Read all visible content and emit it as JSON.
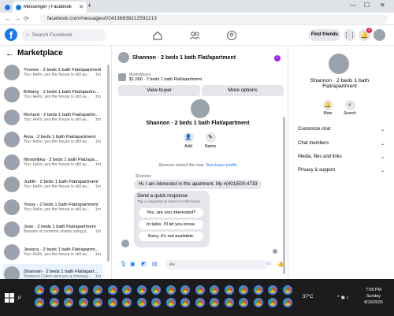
{
  "browser": {
    "tab_inactive_title": "",
    "tab_active_title": "Messenger | Facebook",
    "url": "facebook.com/messages/t/24136838212592213"
  },
  "header": {
    "search_placeholder": "Search Facebook",
    "find_friends": "Find friends",
    "notif_count": "2"
  },
  "sidebar": {
    "title": "Marketplace",
    "conversations": [
      {
        "name": "Yvonne · 2 beds 1 bath Flat/apartment",
        "preview": "You: Hello, yes the house is still av...",
        "time": "1m"
      },
      {
        "name": "Brittany · 2 beds 1 bath Flat/apartm...",
        "preview": "You: Hello, yes the house is still av...",
        "time": "1m"
      },
      {
        "name": "Richard · 2 beds 1 bath Flat/apartm...",
        "preview": "You: Hello, yes the house is still av...",
        "time": "1m"
      },
      {
        "name": "Ama · 2 beds 1 bath Flat/apartment",
        "preview": "You: Hello, yes the house is still av...",
        "time": "1m"
      },
      {
        "name": "Ninoshkka · 2 beds 1 bath Flat/apa...",
        "preview": "You: Hello, yes the house is still av...",
        "time": "1m"
      },
      {
        "name": "Judith · 2 beds 1 bath Flat/apartment",
        "preview": "You: Hello, yes the house is still av...",
        "time": "1m"
      },
      {
        "name": "Yessy · 2 beds 1 bath Flat/apartment",
        "preview": "You: Hello, yes the house is still av...",
        "time": "1m"
      },
      {
        "name": "Jose · 2 beds 1 bath Flat/apartment",
        "preview": "Beware of common scams using p...",
        "time": "1m"
      },
      {
        "name": "Jessica · 2 beds 1 bath Flat/apartm...",
        "preview": "You: Hello, yes the house is still av...",
        "time": "1m"
      },
      {
        "name": "Shannon · 2 beds 1 bath Flat/apart...",
        "preview": "Shannon Coker sent you a messag...",
        "time": "1m"
      }
    ]
  },
  "chat": {
    "title": "Shannon · 2 beds 1 bath Flat/apartment",
    "listing_category": "Marketplace",
    "listing_detail": "$1,000 · 2 beds 1 bath Flat/apartment",
    "view_buyer": "View buyer",
    "more_options": "More options",
    "profile_name": "Shannon · 2 beds 1 bath Flat/apartment",
    "add_label": "Add",
    "name_label": "Name",
    "started_text": "Shannon started this chat.",
    "view_profile": "View buyer profile",
    "sender_name": "Shannon",
    "message": "Hi, I am interested in this apartment. My #(401)500-4733",
    "quick_title": "Send a quick response",
    "quick_sub": "Tap a response to send it to the buyer.",
    "quick_replies": [
      "Yes, are you interested?",
      "In talks. I'll let you know.",
      "Sorry, it's not available."
    ],
    "input_placeholder": "Aa"
  },
  "right_panel": {
    "name": "Shannon · 2 beds 1 bath Flat/apartment",
    "mute": "Mute",
    "search": "Search",
    "sections": [
      "Customize chat",
      "Chat members",
      "Media, files and links",
      "Privacy & support"
    ]
  },
  "taskbar": {
    "temperature": "37°C",
    "time": "7:09 PM",
    "day": "Sunday",
    "date": "8/10/2025"
  },
  "colors": {
    "fb_blue": "#1877f2",
    "selected_row": "#e7f3ff",
    "taskbar": "#1c1c1c"
  }
}
